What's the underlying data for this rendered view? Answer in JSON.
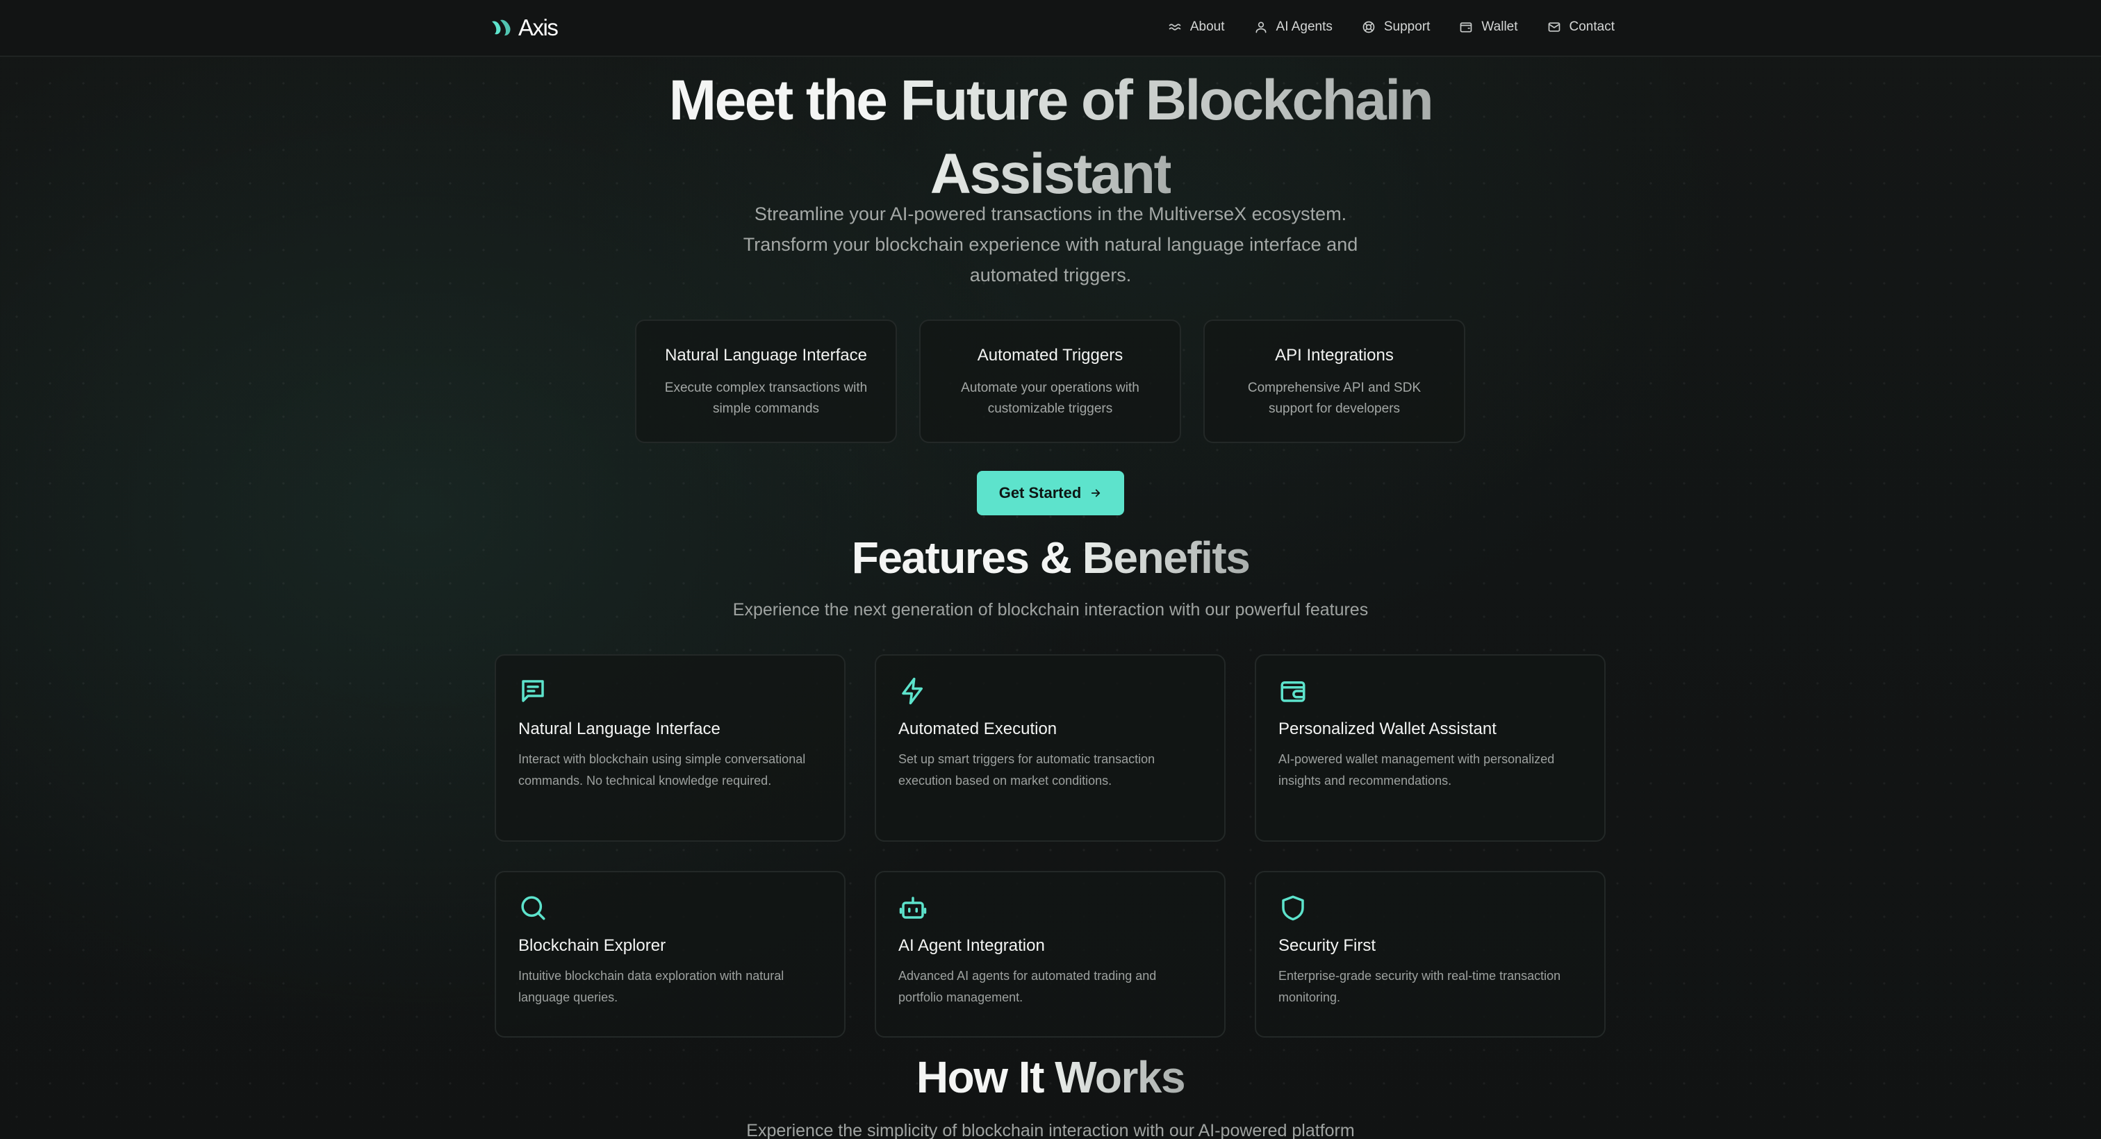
{
  "nav": {
    "logo_text": "Axis",
    "links": [
      {
        "label": "About",
        "icon": "waves-icon"
      },
      {
        "label": "AI Agents",
        "icon": "user-icon"
      },
      {
        "label": "Support",
        "icon": "lifebuoy-icon"
      },
      {
        "label": "Wallet",
        "icon": "wallet-icon"
      },
      {
        "label": "Contact",
        "icon": "mail-icon"
      }
    ]
  },
  "hero": {
    "title_part1": "Meet the ",
    "title_part2": "Future of Blockchain",
    "title_part3": "Assistant",
    "subtitle": "Streamline your AI-powered transactions in the MultiverseX ecosystem. Transform your blockchain experience with natural language interface and automated triggers.",
    "cards": [
      {
        "title": "Natural Language Interface",
        "desc": "Execute complex transactions with simple commands"
      },
      {
        "title": "Automated Triggers",
        "desc": "Automate your operations with customizable triggers"
      },
      {
        "title": "API Integrations",
        "desc": "Comprehensive API and SDK support for developers"
      }
    ],
    "cta_label": "Get Started"
  },
  "features": {
    "title_part1": "Features & ",
    "title_part2": "Benefits",
    "subtitle": "Experience the next generation of blockchain interaction with our powerful features",
    "items": [
      {
        "icon": "message-icon",
        "title": "Natural Language Interface",
        "desc": "Interact with blockchain using simple conversational commands. No technical knowledge required."
      },
      {
        "icon": "lightning-icon",
        "title": "Automated Execution",
        "desc": "Set up smart triggers for automatic transaction execution based on market conditions."
      },
      {
        "icon": "wallet-icon",
        "title": "Personalized Wallet Assistant",
        "desc": "AI-powered wallet management with personalized insights and recommendations."
      },
      {
        "icon": "search-icon",
        "title": "Blockchain Explorer",
        "desc": "Intuitive blockchain data exploration with natural language queries."
      },
      {
        "icon": "robot-icon",
        "title": "AI Agent Integration",
        "desc": "Advanced AI agents for automated trading and portfolio management."
      },
      {
        "icon": "shield-icon",
        "title": "Security First",
        "desc": "Enterprise-grade security with real-time transaction monitoring."
      }
    ]
  },
  "how": {
    "title_part1": "How It ",
    "title_part2": "Works",
    "subtitle": "Experience the simplicity of blockchain interaction with our AI-powered platform"
  },
  "colors": {
    "accent": "#5de3cc",
    "background": "#121414",
    "card_border": "#232827"
  }
}
